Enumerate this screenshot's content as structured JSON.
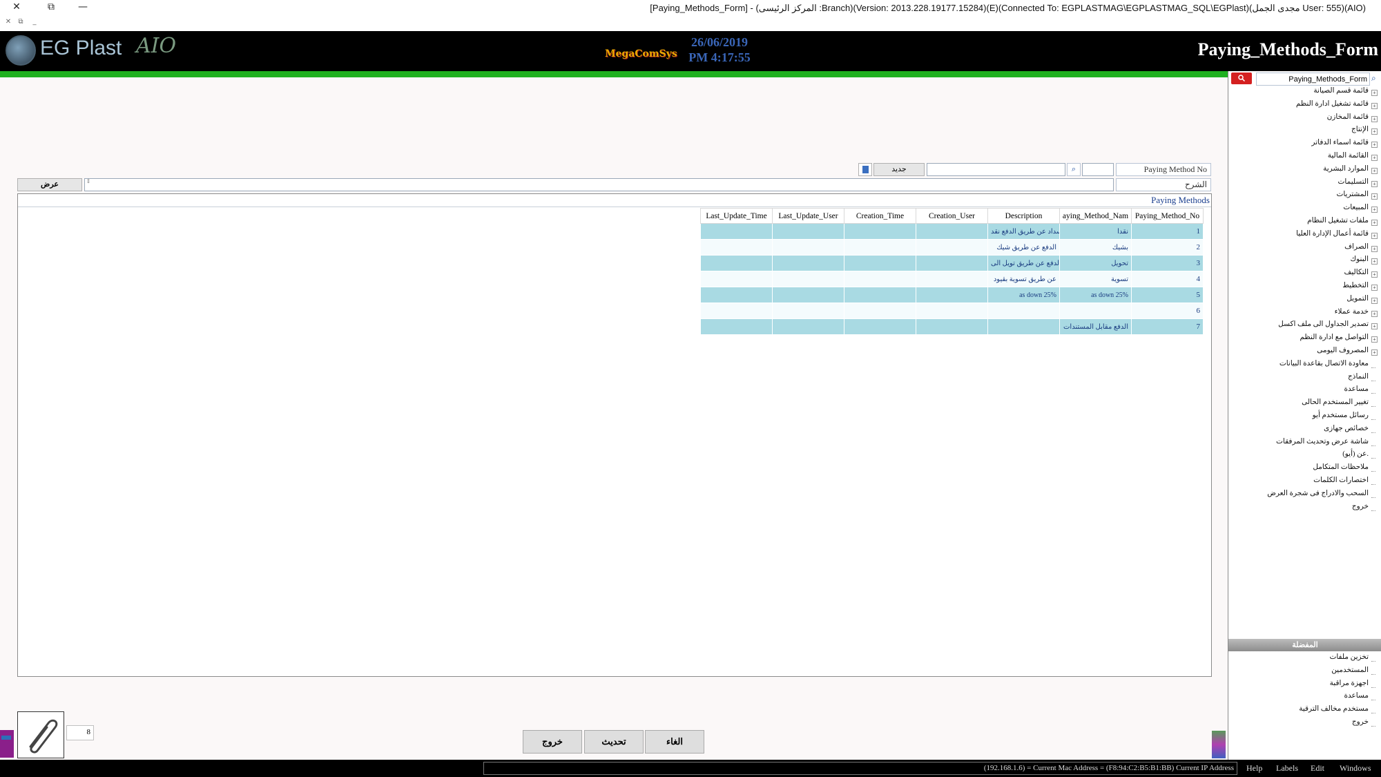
{
  "window": {
    "title": "[Paying_Methods_Form] - (المركز الرئيسى :Branch)(Version: 2013.228.19177.15284)(E)(Connected To: EGPLASTMAG\\EGPLASTMAG_SQL\\EGPlast)(مجدى الجمل User: 555)(AIO)",
    "close_glyph": "✕",
    "restore_glyph": "⧉",
    "minimize_glyph": "—",
    "mdi_close": "✕",
    "mdi_restore": "⧉",
    "mdi_min": "_"
  },
  "banner": {
    "logo_text": "EG Plast",
    "logo_suffix": "AIO",
    "brand": "MegaComSys",
    "date": "26/06/2019",
    "time": "PM 4:17:55",
    "form_title": "Paying_Methods_Form"
  },
  "header": {
    "paying_method_no_label": "Paying Method No",
    "paying_method_no_value": "",
    "search_glyph": "⌕",
    "search_text_value": "",
    "new_button": "جديد",
    "description_label": "الشرح",
    "description_value": "",
    "show_button": "عرض"
  },
  "grid": {
    "caption": "Paying Methods",
    "columns": [
      "Last_Update_Time",
      "Last_Update_User",
      "Creation_Time",
      "Creation_User",
      "Description",
      "aying_Method_Nam",
      "Paying_Method_No"
    ],
    "rows": [
      {
        "no": "1",
        "name": "نقدا",
        "desc": "السداد عن طريق الدفع نقد",
        "cu": "",
        "ct": "",
        "lu": "",
        "lt": ""
      },
      {
        "no": "2",
        "name": "بشيك",
        "desc": "الدفع عن طريق شيك",
        "cu": "",
        "ct": "",
        "lu": "",
        "lt": ""
      },
      {
        "no": "3",
        "name": "تحويل",
        "desc": "الدفع عن طريق تويل الى",
        "cu": "",
        "ct": "",
        "lu": "",
        "lt": ""
      },
      {
        "no": "4",
        "name": "تسوية",
        "desc": "عن طريق تسوية بقيود",
        "cu": "",
        "ct": "",
        "lu": "",
        "lt": ""
      },
      {
        "no": "5",
        "name": "as down 25%",
        "desc": "as down 25%",
        "cu": "",
        "ct": "",
        "lu": "",
        "lt": ""
      },
      {
        "no": "6",
        "name": "",
        "desc": "",
        "cu": "",
        "ct": "",
        "lu": "",
        "lt": ""
      },
      {
        "no": "7",
        "name": "الدفع مقابل المستندات",
        "desc": "",
        "cu": "",
        "ct": "",
        "lu": "",
        "lt": ""
      }
    ]
  },
  "footer": {
    "attachments_count": "8",
    "exit_button": "خروج",
    "refresh_button": "تحديث",
    "cancel_button": "الغاء"
  },
  "sidebar": {
    "search_value": "Paying_Methods_Form",
    "search_button_glyph": "🔍",
    "tree": [
      {
        "label": "قائمة قسم الصيانة",
        "expandable": true
      },
      {
        "label": "قائمة تشغيل ادارة النظم",
        "expandable": true
      },
      {
        "label": "قائمة المخازن",
        "expandable": true
      },
      {
        "label": "الإنتاج",
        "expandable": true
      },
      {
        "label": "قائمة اسماء الدفاتر",
        "expandable": true
      },
      {
        "label": "القائمة المالية",
        "expandable": true
      },
      {
        "label": "الموارد البشرية",
        "expandable": true
      },
      {
        "label": "التسليمات",
        "expandable": true
      },
      {
        "label": "المشتريات",
        "expandable": true
      },
      {
        "label": "المبيعات",
        "expandable": true
      },
      {
        "label": "ملفات تشغيل النظام",
        "expandable": true
      },
      {
        "label": "قائمة أعمال الإدارة العليا",
        "expandable": true
      },
      {
        "label": "الصراف",
        "expandable": true
      },
      {
        "label": "البنوك",
        "expandable": true
      },
      {
        "label": "التكاليف",
        "expandable": true
      },
      {
        "label": "التخطيط",
        "expandable": true
      },
      {
        "label": "التمويل",
        "expandable": true
      },
      {
        "label": "خدمة عملاء",
        "expandable": true
      },
      {
        "label": "تصدير الجداول الى ملف اكسل",
        "expandable": true
      },
      {
        "label": "التواصل مع ادارة النظم",
        "expandable": true
      },
      {
        "label": "المصروف اليومى",
        "expandable": true
      },
      {
        "label": "معاودة الاتصال بقاعدة البيانات",
        "expandable": false
      },
      {
        "label": "النماذج",
        "expandable": false
      },
      {
        "label": "مساعدة",
        "expandable": false
      },
      {
        "label": "تغيير المستخدم الحالى",
        "expandable": false
      },
      {
        "label": "رسائل مستخدم أيو",
        "expandable": false
      },
      {
        "label": "خصائص جهازى",
        "expandable": false
      },
      {
        "label": "شاشة عرض وتحديث المرفقات",
        "expandable": false
      },
      {
        "label": "عن (أيو).",
        "expandable": false
      },
      {
        "label": "ملاحظات المتكامل",
        "expandable": false
      },
      {
        "label": "اختصارات الكلمات",
        "expandable": false
      },
      {
        "label": "السحب والادراج فى شجرة العرض",
        "expandable": false
      },
      {
        "label": "خروج",
        "expandable": false
      }
    ],
    "favorites_header": "المفضلة",
    "favorites": [
      "تخزين ملفات",
      "المستخدمين",
      "اجهزة مراقبة",
      "مساعدة",
      "مستخدم مخالف الترقية",
      "خروج"
    ]
  },
  "statusbar": {
    "text": "(192.168.1.6) = Current Mac Address = (F8:94:C2:B5:B1:BB) Current IP Address",
    "menu": [
      "Help",
      "Labels",
      "Edit",
      "Windows"
    ]
  },
  "colors": {
    "accent_green": "#1fb01f",
    "row_highlight": "#a9dae3",
    "banner_blue_text": "#3a66b8"
  }
}
